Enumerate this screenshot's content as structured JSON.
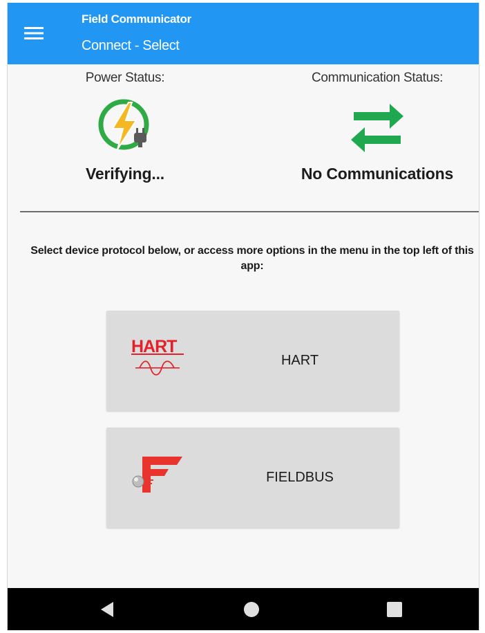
{
  "appbar": {
    "title": "Field Communicator",
    "subtitle": "Connect - Select",
    "menu_icon": "hamburger-menu-icon"
  },
  "status": {
    "power": {
      "label": "Power Status:",
      "value": "Verifying...",
      "icon": "power-plug-icon"
    },
    "communication": {
      "label": "Communication Status:",
      "value": "No Communications",
      "icon": "swap-arrows-icon"
    }
  },
  "instructions": "Select device protocol below, or access more options in the menu in the top left of this app:",
  "protocols": [
    {
      "label": "HART",
      "logo": "hart-logo",
      "logo_text": "HART"
    },
    {
      "label": "FIELDBUS",
      "logo": "fieldbus-logo"
    }
  ],
  "navbar": {
    "back_icon": "back-triangle-icon",
    "home_icon": "home-circle-icon",
    "recents_icon": "recents-square-icon"
  },
  "colors": {
    "appbar": "#2196f3",
    "arrows_green": "#1fa84f",
    "power_green": "#2faa45",
    "lightning_yellow": "#f6b822",
    "hart_red": "#e2222a",
    "fieldbus_red": "#e8342c",
    "button_gray": "#dcdcdc"
  }
}
